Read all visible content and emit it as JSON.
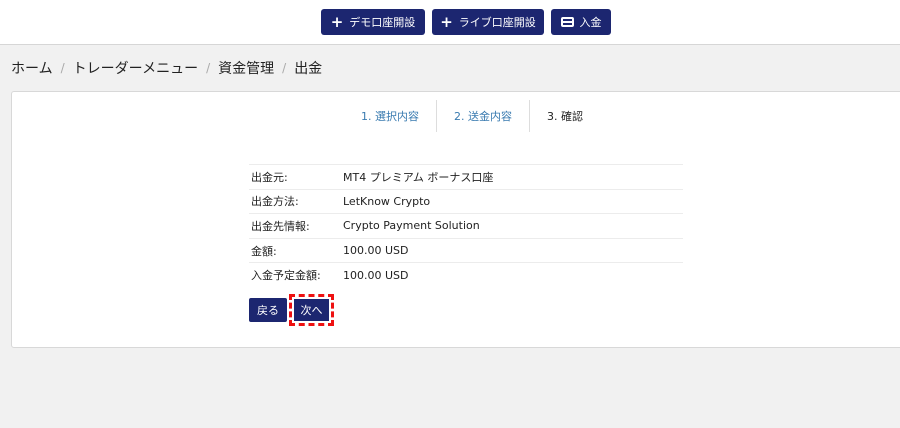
{
  "header": {
    "demo_label": "デモ口座開設",
    "live_label": "ライブ口座開設",
    "deposit_label": "入金"
  },
  "breadcrumb": [
    "ホーム",
    "トレーダーメニュー",
    "資金管理",
    "出金"
  ],
  "steps": [
    {
      "label": "1. 選択内容",
      "state": "done"
    },
    {
      "label": "2. 送金内容",
      "state": "done"
    },
    {
      "label": "3. 確認",
      "state": "active"
    }
  ],
  "details": [
    {
      "label": "出金元:",
      "value": "MT4 プレミアム ボーナス口座"
    },
    {
      "label": "出金方法:",
      "value": "LetKnow Crypto"
    },
    {
      "label": "出金先情報:",
      "value": "Crypto Payment Solution"
    },
    {
      "label": "金額:",
      "value": "100.00 USD"
    },
    {
      "label": "入金予定金額:",
      "value": "100.00 USD"
    }
  ],
  "actions": {
    "back_label": "戻る",
    "next_label": "次へ"
  },
  "colors": {
    "primary": "#1c2670",
    "step_done": "#3a7bb0",
    "highlight": "#e11111"
  }
}
